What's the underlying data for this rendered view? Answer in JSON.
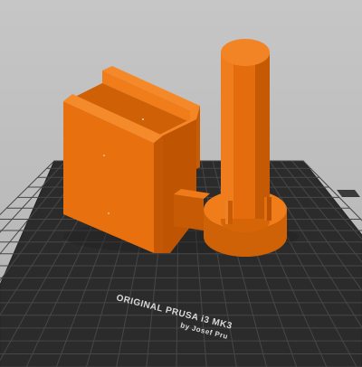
{
  "viewport": {
    "bed_label_line1": "ORIGINAL PRUSA i3 MK3",
    "bed_label_line2": "by Josef Pru"
  },
  "colors": {
    "background": "#b8b8b8",
    "bed": "#2b2b2b",
    "grid_line": "#4a4a4a",
    "model_orange": "#e26a0a",
    "model_shadow": "#b44f02",
    "model_highlight": "#f07c1a"
  },
  "objects": [
    {
      "name": "u-channel-holder-model"
    },
    {
      "name": "cylinder-post-model"
    }
  ]
}
